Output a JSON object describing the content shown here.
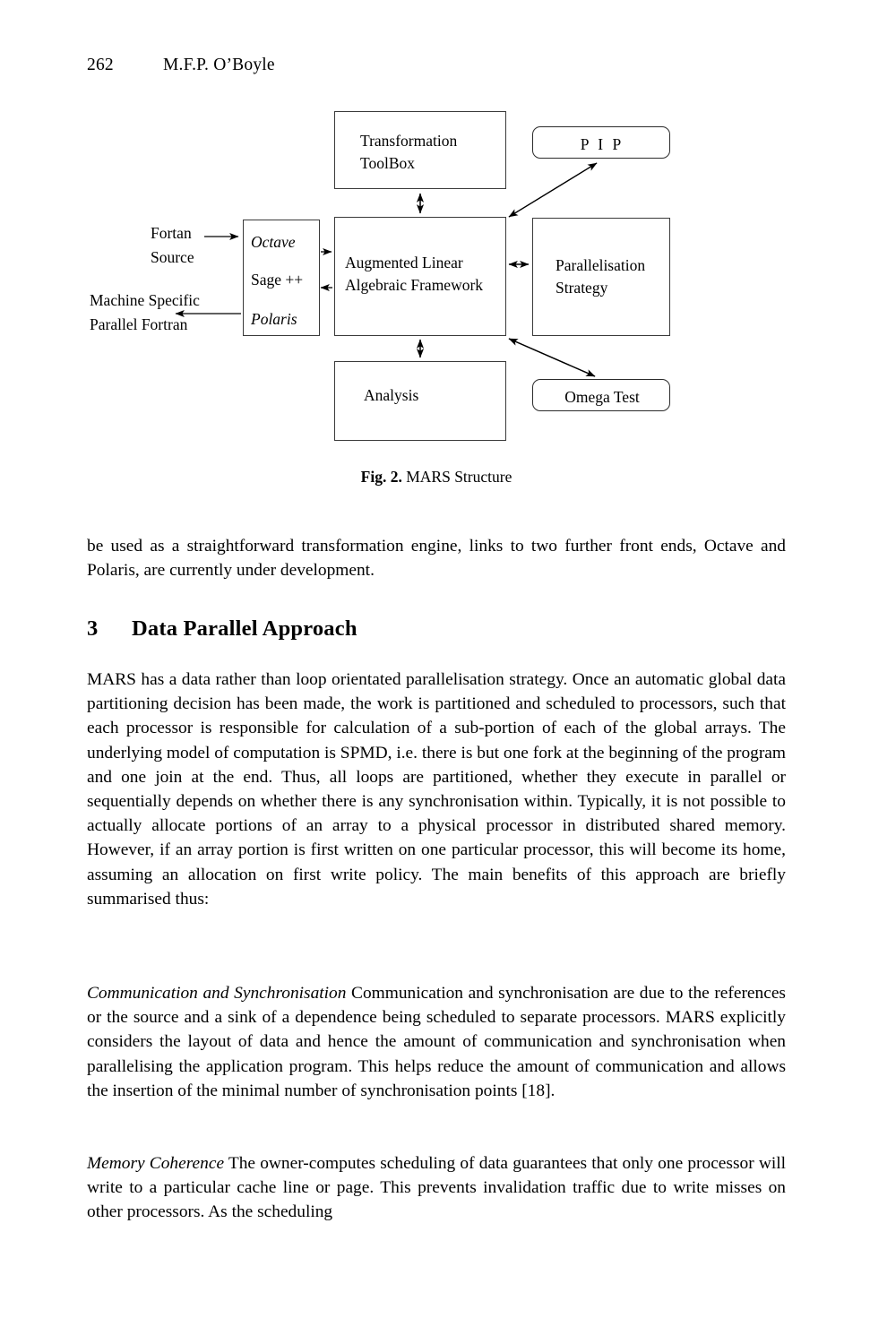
{
  "running_head": {
    "page_number": "262",
    "author": "M.F.P. O’Boyle"
  },
  "figure": {
    "caption_label": "Fig. 2.",
    "caption_text": "MARS Structure",
    "boxes": {
      "transformation": "Transformation\nToolBox",
      "pip": "P I P",
      "frontend_octave": "Octave",
      "frontend_sage": "Sage ++",
      "frontend_polaris": "Polaris",
      "alaf": "Augmented Linear\nAlgebraic Framework",
      "parallelisation": "Parallelisation\nStrategy",
      "analysis": "Analysis",
      "omega": "Omega Test"
    },
    "labels": {
      "input_source": "Fortan\nSource",
      "output_target": "Machine Specific\nParallel Fortran"
    }
  },
  "body": {
    "intro": "be used as a straightforward transformation engine, links to two further front ends, Octave and Polaris, are currently under development.",
    "section": {
      "number": "3",
      "title": "Data Parallel Approach"
    },
    "main": "MARS has a data rather than loop orientated parallelisation strategy. Once an automatic global data partitioning decision has been made, the work is partitioned and scheduled to processors, such that each processor is responsible for calculation of a sub-portion of each of the global arrays. The underlying model of computation is SPMD, i.e. there is but one fork at the beginning of the program and one join at the end. Thus, all loops are partitioned, whether they execute in parallel or sequentially depends on whether there is any synchronisation within. Typically, it is not possible to actually allocate portions of an array to a physical processor in distributed shared memory. However, if an array portion is first written on one particular processor, this will become its home, assuming an allocation on first write policy. The main benefits of this approach are briefly summarised thus:",
    "communication": {
      "runin": "Communication and Synchronisation",
      "text": " Communication and synchronisation are due to the references or the source and a sink of a dependence being scheduled to separate processors. MARS explicitly considers the layout of data and hence the amount of communication and synchronisation when parallelising the application program. This helps reduce the amount of communication and allows the insertion of the minimal number of synchronisation points [18]."
    },
    "memory": {
      "runin": "Memory Coherence",
      "text": " The owner-computes scheduling of data guarantees that only one processor will write to a particular cache line or page. This prevents invalidation traffic due to write misses on other processors. As the scheduling"
    }
  }
}
